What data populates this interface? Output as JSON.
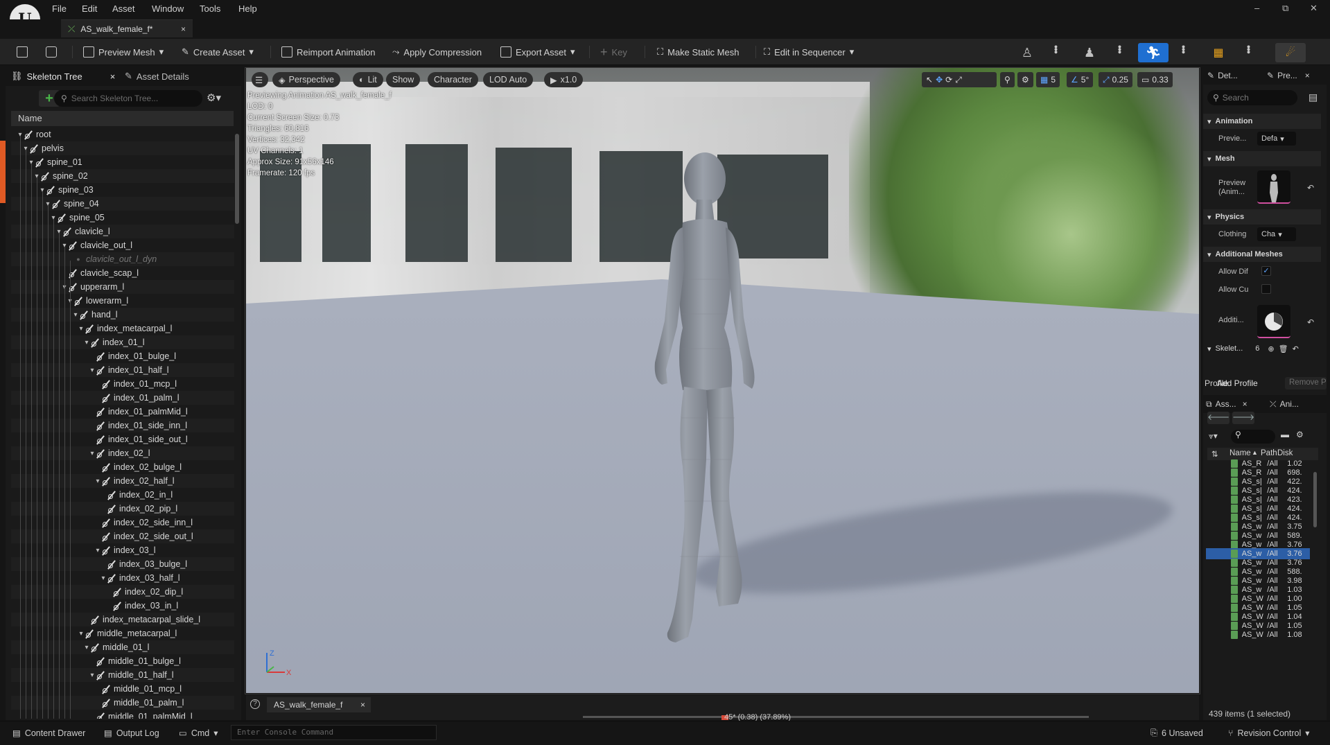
{
  "menu": [
    "File",
    "Edit",
    "Asset",
    "Window",
    "Tools",
    "Help"
  ],
  "doc_tab": {
    "title": "AS_walk_female_f*",
    "close": "×"
  },
  "window_controls": {
    "minimize": "–",
    "restore": "⧉",
    "close": "✕"
  },
  "toolbar": {
    "preview_mesh": "Preview Mesh",
    "create_asset": "Create Asset",
    "reimport": "Reimport Animation",
    "apply_compression": "Apply Compression",
    "export_asset": "Export Asset",
    "key": "Key",
    "make_static_mesh": "Make Static Mesh",
    "edit_in_sequencer": "Edit in Sequencer"
  },
  "left_panel": {
    "tab_skeleton": "Skeleton Tree",
    "tab_details": "Asset Details",
    "search_placeholder": "Search Skeleton Tree...",
    "col_name": "Name",
    "bones": [
      {
        "name": "root",
        "depth": 0,
        "arrow": true
      },
      {
        "name": "pelvis",
        "depth": 1,
        "arrow": true
      },
      {
        "name": "spine_01",
        "depth": 2,
        "arrow": true
      },
      {
        "name": "spine_02",
        "depth": 3,
        "arrow": true
      },
      {
        "name": "spine_03",
        "depth": 4,
        "arrow": true
      },
      {
        "name": "spine_04",
        "depth": 5,
        "arrow": true
      },
      {
        "name": "spine_05",
        "depth": 6,
        "arrow": true
      },
      {
        "name": "clavicle_l",
        "depth": 7,
        "arrow": true
      },
      {
        "name": "clavicle_out_l",
        "depth": 8,
        "arrow": true
      },
      {
        "name": "clavicle_out_l_dyn",
        "depth": 9,
        "arrow": false,
        "dim": true
      },
      {
        "name": "clavicle_scap_l",
        "depth": 8,
        "arrow": false
      },
      {
        "name": "upperarm_l",
        "depth": 8,
        "arrow": true
      },
      {
        "name": "lowerarm_l",
        "depth": 9,
        "arrow": true
      },
      {
        "name": "hand_l",
        "depth": 10,
        "arrow": true
      },
      {
        "name": "index_metacarpal_l",
        "depth": 11,
        "arrow": true
      },
      {
        "name": "index_01_l",
        "depth": 12,
        "arrow": true
      },
      {
        "name": "index_01_bulge_l",
        "depth": 13,
        "arrow": false
      },
      {
        "name": "index_01_half_l",
        "depth": 13,
        "arrow": true
      },
      {
        "name": "index_01_mcp_l",
        "depth": 14,
        "arrow": false
      },
      {
        "name": "index_01_palm_l",
        "depth": 14,
        "arrow": false
      },
      {
        "name": "index_01_palmMid_l",
        "depth": 13,
        "arrow": false
      },
      {
        "name": "index_01_side_inn_l",
        "depth": 13,
        "arrow": false
      },
      {
        "name": "index_01_side_out_l",
        "depth": 13,
        "arrow": false
      },
      {
        "name": "index_02_l",
        "depth": 13,
        "arrow": true
      },
      {
        "name": "index_02_bulge_l",
        "depth": 14,
        "arrow": false
      },
      {
        "name": "index_02_half_l",
        "depth": 14,
        "arrow": true
      },
      {
        "name": "index_02_in_l",
        "depth": 15,
        "arrow": false
      },
      {
        "name": "index_02_pip_l",
        "depth": 15,
        "arrow": false
      },
      {
        "name": "index_02_side_inn_l",
        "depth": 14,
        "arrow": false
      },
      {
        "name": "index_02_side_out_l",
        "depth": 14,
        "arrow": false
      },
      {
        "name": "index_03_l",
        "depth": 14,
        "arrow": true
      },
      {
        "name": "index_03_bulge_l",
        "depth": 15,
        "arrow": false
      },
      {
        "name": "index_03_half_l",
        "depth": 15,
        "arrow": true
      },
      {
        "name": "index_02_dip_l",
        "depth": 16,
        "arrow": false
      },
      {
        "name": "index_03_in_l",
        "depth": 16,
        "arrow": false
      },
      {
        "name": "index_metacarpal_slide_l",
        "depth": 12,
        "arrow": false
      },
      {
        "name": "middle_metacarpal_l",
        "depth": 11,
        "arrow": true
      },
      {
        "name": "middle_01_l",
        "depth": 12,
        "arrow": true
      },
      {
        "name": "middle_01_bulge_l",
        "depth": 13,
        "arrow": false
      },
      {
        "name": "middle_01_half_l",
        "depth": 13,
        "arrow": true
      },
      {
        "name": "middle_01_mcp_l",
        "depth": 14,
        "arrow": false
      },
      {
        "name": "middle_01_palm_l",
        "depth": 14,
        "arrow": false
      },
      {
        "name": "middle_01_palmMid_l",
        "depth": 13,
        "arrow": false
      }
    ]
  },
  "viewport": {
    "perspective": "Perspective",
    "lit": "Lit",
    "show": "Show",
    "character": "Character",
    "lod": "LOD Auto",
    "speed": "x1.0",
    "stats": [
      "Previewing Animation AS_walk_female_f",
      "LOD: 0",
      "Current Screen Size: 0.73",
      "Triangles: 60,816",
      "Vertices: 32,342",
      "UV Channels: 1",
      "Approx Size: 91x56x146",
      "Framerate: 120 fps"
    ],
    "grid_snap": "5",
    "rot_snap": "5°",
    "scale_snap": "0.25",
    "cam_speed": "0.33",
    "axis_z": "Z",
    "axis_x": "X"
  },
  "timeline": {
    "tab": "AS_walk_female_f",
    "close": "×",
    "frame_readout": "45* (0.38) (37.89%)",
    "help": "?"
  },
  "right_panel": {
    "tab_details": "Det...",
    "tab_preview": "Pre...",
    "search_placeholder": "Search",
    "sections": {
      "animation": "Animation",
      "mesh": "Mesh",
      "physics": "Physics",
      "additional_meshes": "Additional Meshes",
      "skeleton": "Skelet..."
    },
    "props": {
      "preview": "Previe...",
      "preview_value": "Defa",
      "preview_anim": "Preview (Anim...",
      "clothing": "Clothing",
      "clothing_value": "Cha",
      "allow_dif": "Allow Dif",
      "allow_cu": "Allow Cu",
      "additional": "Additi...",
      "skeleton_count": "6"
    },
    "profile": "Profile",
    "add_profile": "Add Profile",
    "remove_profile": "Remove P",
    "asset_tab1": "Ass...",
    "asset_tab2": "Ani...",
    "asset_cols": {
      "name": "Name",
      "path": "Path",
      "disk": "Disk"
    },
    "assets": [
      {
        "name": "AS_R",
        "path": "/All",
        "disk": "1.02"
      },
      {
        "name": "AS_R",
        "path": "/All",
        "disk": "698."
      },
      {
        "name": "AS_s|",
        "path": "/All",
        "disk": "422."
      },
      {
        "name": "AS_s|",
        "path": "/All",
        "disk": "424."
      },
      {
        "name": "AS_s|",
        "path": "/All",
        "disk": "423."
      },
      {
        "name": "AS_s|",
        "path": "/All",
        "disk": "424."
      },
      {
        "name": "AS_s|",
        "path": "/All",
        "disk": "424."
      },
      {
        "name": "AS_w",
        "path": "/All",
        "disk": "3.75"
      },
      {
        "name": "AS_w",
        "path": "/All",
        "disk": "589."
      },
      {
        "name": "AS_w",
        "path": "/All",
        "disk": "3.76"
      },
      {
        "name": "AS_w",
        "path": "/All",
        "disk": "3.76"
      },
      {
        "name": "AS_w",
        "path": "/All",
        "disk": "3.76"
      },
      {
        "name": "AS_w",
        "path": "/All",
        "disk": "588."
      },
      {
        "name": "AS_w",
        "path": "/All",
        "disk": "3.98"
      },
      {
        "name": "AS_w",
        "path": "/All",
        "disk": "1.03"
      },
      {
        "name": "AS_W",
        "path": "/All",
        "disk": "1.00"
      },
      {
        "name": "AS_W",
        "path": "/All",
        "disk": "1.05"
      },
      {
        "name": "AS_W",
        "path": "/All",
        "disk": "1.04"
      },
      {
        "name": "AS_W",
        "path": "/All",
        "disk": "1.05"
      },
      {
        "name": "AS_W",
        "path": "/All",
        "disk": "1.08"
      }
    ],
    "selected_index": 10,
    "item_count": "439 items (1 selected)"
  },
  "statusbar": {
    "content_drawer": "Content Drawer",
    "output_log": "Output Log",
    "cmd": "Cmd",
    "console_placeholder": "Enter Console Command",
    "unsaved": "6 Unsaved",
    "revision": "Revision Control"
  },
  "colors": {
    "accent_blue": "#1f6fd1",
    "add_green": "#49b548",
    "selection": "#2c5ea6",
    "asset_icon": "#5a9d55"
  }
}
